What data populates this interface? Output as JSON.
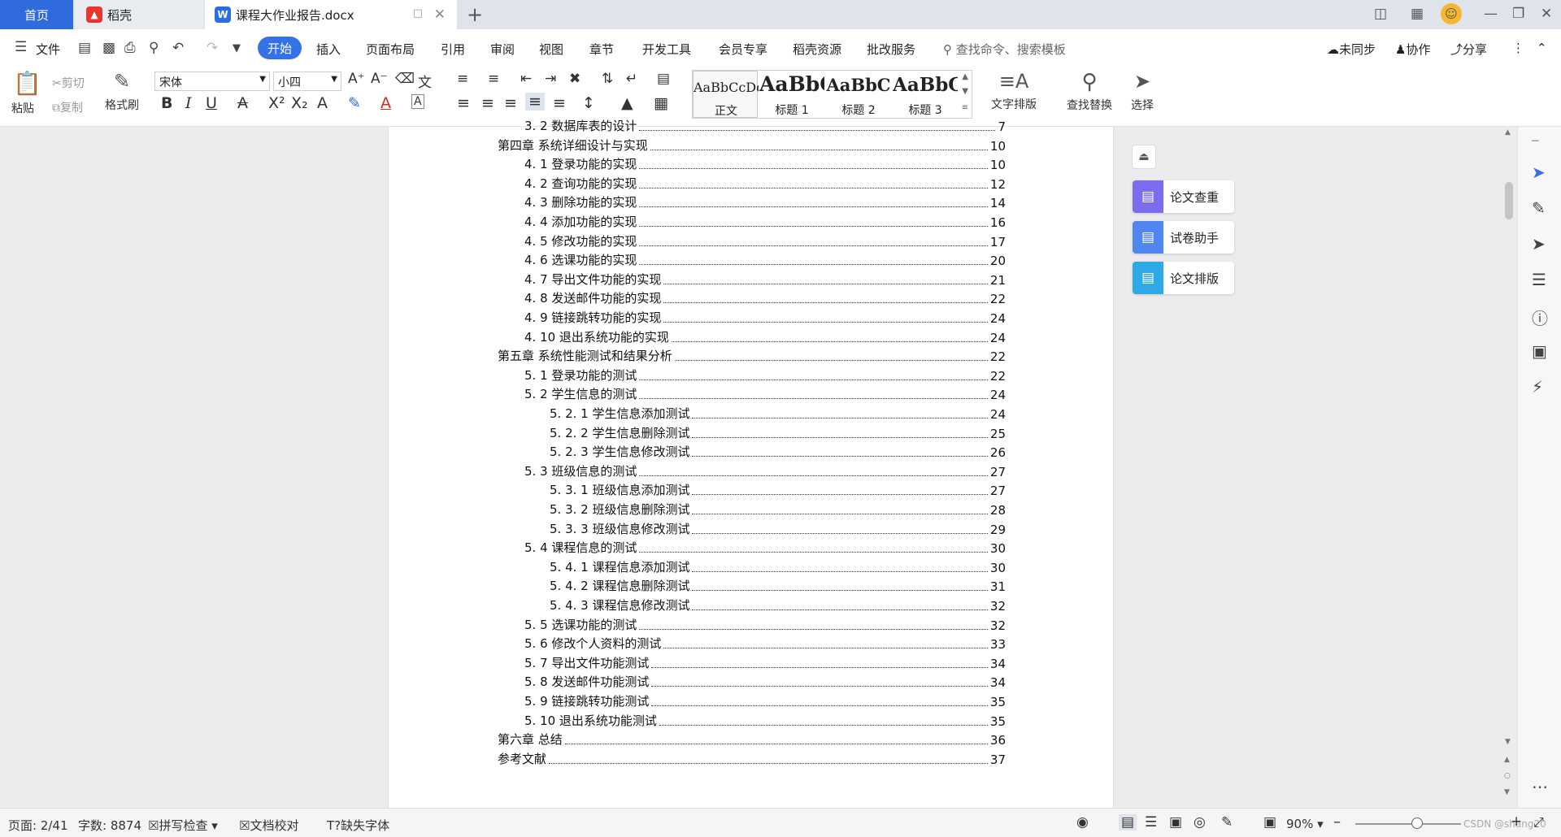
{
  "tabs": {
    "home": "首页",
    "daoke": "稻壳",
    "document": "课程大作业报告.docx"
  },
  "menu": {
    "file": "文件",
    "items": [
      "开始",
      "插入",
      "页面布局",
      "引用",
      "审阅",
      "视图",
      "章节",
      "开发工具",
      "会员专享",
      "稻壳资源",
      "批改服务"
    ],
    "search": "查找命令、搜索模板",
    "sync": "未同步",
    "collab": "协作",
    "share": "分享"
  },
  "ribbon": {
    "paste": "粘贴",
    "cut": "剪切",
    "copy": "复制",
    "format_painter": "格式刷",
    "font_name": "宋体",
    "font_size": "小四",
    "styles": [
      {
        "preview": "AaBbCcDd",
        "name": "正文"
      },
      {
        "preview": "AaBbC",
        "name": "标题 1"
      },
      {
        "preview": "AaBbC",
        "name": "标题 2"
      },
      {
        "preview": "AaBbC",
        "name": "标题 3"
      }
    ],
    "text_layout": "文字排版",
    "find_replace": "查找替换",
    "select": "选择"
  },
  "toc": [
    {
      "indent": 1,
      "title": "3. 2  数据库表的设计",
      "page": "7"
    },
    {
      "indent": 0,
      "title": "第四章  系统详细设计与实现",
      "page": "10"
    },
    {
      "indent": 1,
      "title": "4. 1  登录功能的实现",
      "page": "10"
    },
    {
      "indent": 1,
      "title": "4. 2  查询功能的实现",
      "page": "12"
    },
    {
      "indent": 1,
      "title": "4. 3  删除功能的实现",
      "page": "14"
    },
    {
      "indent": 1,
      "title": "4. 4  添加功能的实现",
      "page": "16"
    },
    {
      "indent": 1,
      "title": "4. 5  修改功能的实现",
      "page": "17"
    },
    {
      "indent": 1,
      "title": "4. 6  选课功能的实现",
      "page": "20"
    },
    {
      "indent": 1,
      "title": "4. 7  导出文件功能的实现",
      "page": "21"
    },
    {
      "indent": 1,
      "title": "4. 8  发送邮件功能的实现",
      "page": "22"
    },
    {
      "indent": 1,
      "title": "4. 9  链接跳转功能的实现",
      "page": "24"
    },
    {
      "indent": 1,
      "title": "4. 10  退出系统功能的实现",
      "page": "24"
    },
    {
      "indent": 0,
      "title": "第五章  系统性能测试和结果分析",
      "page": "22"
    },
    {
      "indent": 1,
      "title": "5. 1  登录功能的测试",
      "page": "22"
    },
    {
      "indent": 1,
      "title": "5. 2  学生信息的测试",
      "page": "24"
    },
    {
      "indent": 2,
      "title": "5. 2. 1  学生信息添加测试",
      "page": "24"
    },
    {
      "indent": 2,
      "title": "5. 2. 2  学生信息删除测试",
      "page": "25"
    },
    {
      "indent": 2,
      "title": "5. 2. 3  学生信息修改测试",
      "page": "26"
    },
    {
      "indent": 1,
      "title": "5. 3  班级信息的测试",
      "page": "27"
    },
    {
      "indent": 2,
      "title": "5. 3. 1  班级信息添加测试",
      "page": "27"
    },
    {
      "indent": 2,
      "title": "5. 3. 2  班级信息删除测试",
      "page": "28"
    },
    {
      "indent": 2,
      "title": "5. 3. 3  班级信息修改测试",
      "page": "29"
    },
    {
      "indent": 1,
      "title": "5. 4  课程信息的测试",
      "page": "30"
    },
    {
      "indent": 2,
      "title": "5. 4. 1  课程信息添加测试",
      "page": "30"
    },
    {
      "indent": 2,
      "title": "5. 4. 2  课程信息删除测试",
      "page": "31"
    },
    {
      "indent": 2,
      "title": "5. 4. 3  课程信息修改测试",
      "page": "32"
    },
    {
      "indent": 1,
      "title": "5. 5  选课功能的测试",
      "page": "32"
    },
    {
      "indent": 1,
      "title": "5. 6  修改个人资料的测试",
      "page": "33"
    },
    {
      "indent": 1,
      "title": "5. 7  导出文件功能测试",
      "page": "34"
    },
    {
      "indent": 1,
      "title": "5. 8  发送邮件功能测试",
      "page": "34"
    },
    {
      "indent": 1,
      "title": "5. 9  链接跳转功能测试",
      "page": "35"
    },
    {
      "indent": 1,
      "title": "5. 10  退出系统功能测试",
      "page": "35"
    },
    {
      "indent": 0,
      "title": "第六章  总结",
      "page": "36"
    },
    {
      "indent": 0,
      "title": "参考文献",
      "page": "37"
    }
  ],
  "helper": [
    {
      "label": "论文查重",
      "color": "#7b6cf0"
    },
    {
      "label": "试卷助手",
      "color": "#4f86f0"
    },
    {
      "label": "论文排版",
      "color": "#2fa8e8"
    }
  ],
  "status": {
    "page": "页面: 2/41",
    "words": "字数: 8874",
    "spell": "拼写检查",
    "proof": "文档校对",
    "missing_font": "缺失字体",
    "zoom": "90%",
    "watermark": "CSDN @shang20"
  },
  "colors": {
    "accent": "#3472e8",
    "home_tab": "#2f6bdc"
  }
}
